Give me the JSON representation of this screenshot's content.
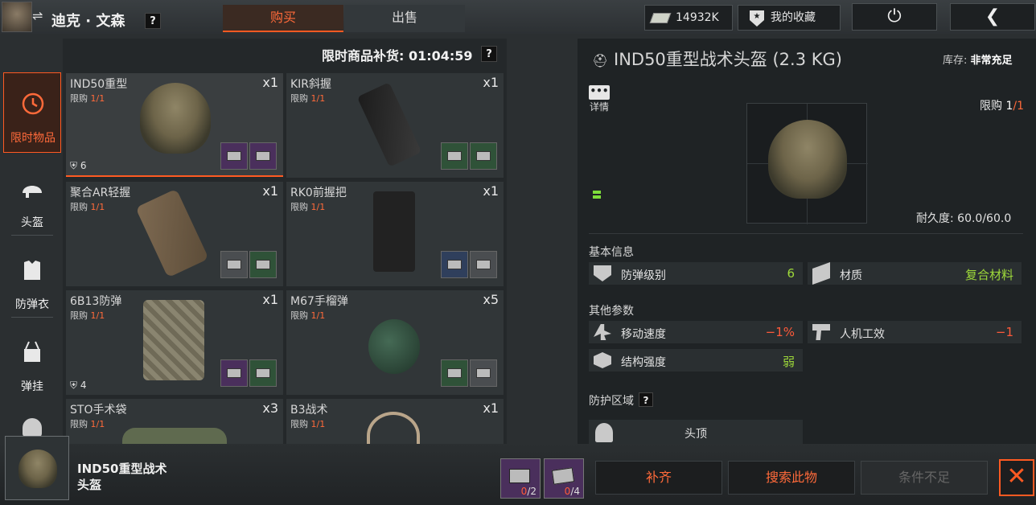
{
  "player": {
    "name": "迪克 · 文森",
    "swap_icon": "⇌",
    "help": "?"
  },
  "tabs": {
    "buy": "购买",
    "sell": "出售"
  },
  "header": {
    "money": "14932K",
    "favorites": "我的收藏"
  },
  "shop": {
    "restock_label": "限时商品补货: 01:04:59",
    "help": "?",
    "categories": [
      {
        "label": "限时物品",
        "icon": "clock-icon",
        "active": true
      },
      {
        "label": "头盔",
        "icon": "helmet-icon"
      },
      {
        "label": "防弹衣",
        "icon": "vest-icon"
      },
      {
        "label": "弹挂",
        "icon": "chest-rig-icon"
      }
    ],
    "items": [
      {
        "name": "IND50重型",
        "qty": "x1",
        "limit_prefix": "限购 ",
        "limit": "1/1",
        "armor": "6"
      },
      {
        "name": "KIR斜握",
        "qty": "x1",
        "limit_prefix": "限购 ",
        "limit": "1/1"
      },
      {
        "name": "聚合AR轻握",
        "qty": "x1",
        "limit_prefix": "限购 ",
        "limit": "1/1"
      },
      {
        "name": "RK0前握把",
        "qty": "x1",
        "limit_prefix": "限购 ",
        "limit": "1/1"
      },
      {
        "name": "6B13防弹",
        "qty": "x1",
        "limit_prefix": "限购 ",
        "limit": "1/1",
        "armor": "4"
      },
      {
        "name": "M67手榴弹",
        "qty": "x5",
        "limit_prefix": "限购 ",
        "limit": "1/1"
      },
      {
        "name": "STO手术袋",
        "qty": "x3",
        "limit_prefix": "限购 ",
        "limit": "1/1"
      },
      {
        "name": "B3战术",
        "qty": "x1",
        "limit_prefix": "限购 ",
        "limit": "1/1"
      }
    ]
  },
  "detail": {
    "title": "IND50重型战术头盔 (2.3 KG)",
    "stock_label": "库存: ",
    "stock_value": "非常充足",
    "details_label": "详情",
    "limit_prefix": "限购 ",
    "limit_num": "1",
    "limit_total": "/1",
    "durability": "耐久度: 60.0/60.0",
    "basic_info": "基本信息",
    "other_params": "其他参数",
    "protect_zone": "防护区域",
    "help": "?",
    "stats": {
      "armor_class": {
        "label": "防弹级别",
        "value": "6"
      },
      "material": {
        "label": "材质",
        "value": "复合材料"
      },
      "move_speed": {
        "label": "移动速度",
        "value": "−1%"
      },
      "ergonomics": {
        "label": "人机工效",
        "value": "−1"
      },
      "structure": {
        "label": "结构强度",
        "value": "弱"
      }
    },
    "zone": "头顶"
  },
  "bottom": {
    "item_name_line1": "IND50重型战术",
    "item_name_line2": "头盔",
    "req1": {
      "have": "0",
      "need": "/2"
    },
    "req2": {
      "have": "0",
      "need": "/4"
    },
    "btn_fill": "补齐",
    "btn_search": "搜索此物",
    "btn_condition": "条件不足",
    "close": "✕"
  },
  "colors": {
    "accent": "#ff5a22",
    "positive": "#9ed93a",
    "negative": "#ff5a3a"
  }
}
